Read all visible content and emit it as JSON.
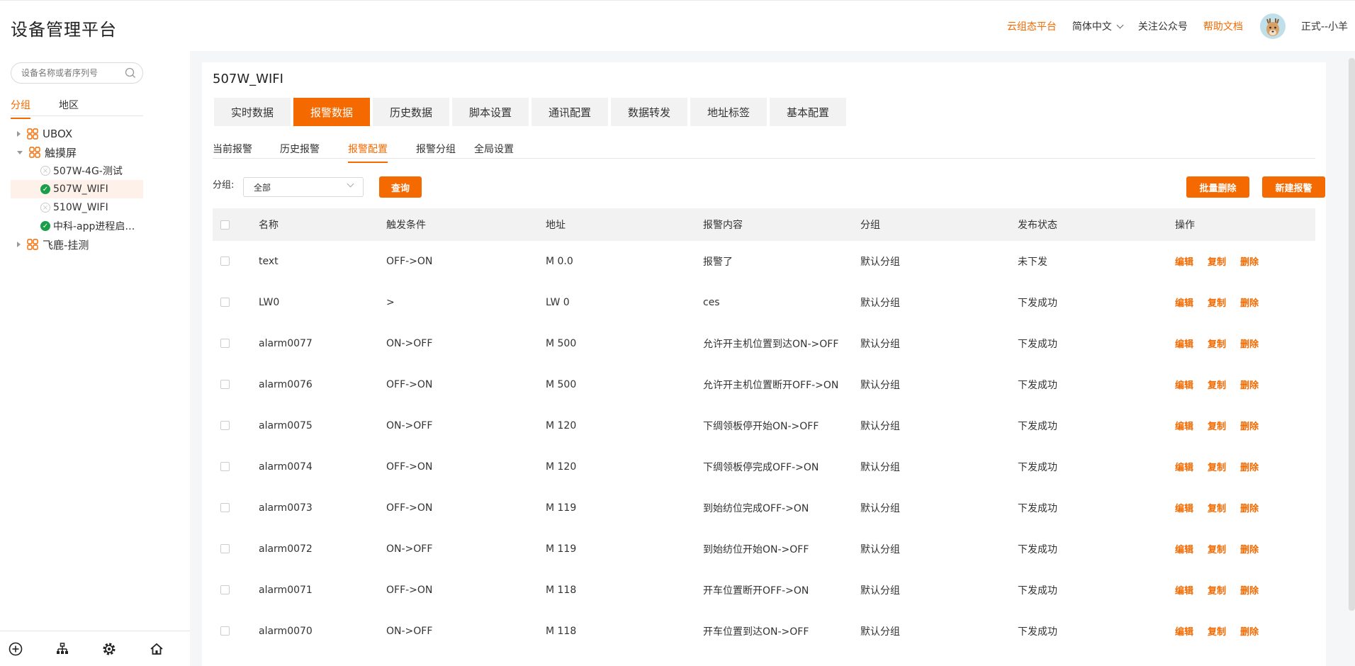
{
  "app": {
    "title": "设备管理平台"
  },
  "topnav": {
    "cloud": "云组态平台",
    "lang": "简体中文",
    "follow": "关注公众号",
    "help": "帮助文档",
    "user": "正式--小羊"
  },
  "sidebar": {
    "search_placeholder": "设备名称或者序列号",
    "tabs": [
      "分组",
      "地区"
    ],
    "tree": [
      {
        "label": "UBOX",
        "expanded": false,
        "children": []
      },
      {
        "label": "触摸屏",
        "expanded": true,
        "children": [
          {
            "label": "507W-4G-测试",
            "status": "offline"
          },
          {
            "label": "507W_WIFI",
            "status": "online",
            "selected": true
          },
          {
            "label": "510W_WIFI",
            "status": "offline"
          },
          {
            "label": "中科-app进程启…",
            "status": "online"
          }
        ]
      },
      {
        "label": "飞鹿-挂测",
        "expanded": false,
        "children": []
      }
    ]
  },
  "main": {
    "device_title": "507W_WIFI",
    "tabs": [
      "实时数据",
      "报警数据",
      "历史数据",
      "脚本设置",
      "通讯配置",
      "数据转发",
      "地址标签",
      "基本配置"
    ],
    "active_tab": 1,
    "subtabs": [
      "当前报警",
      "历史报警",
      "报警配置",
      "报警分组",
      "全局设置"
    ],
    "active_subtab": 2,
    "filter_label": "分组:",
    "filter_value": "全部",
    "query_btn": "查询",
    "batch_delete_btn": "批量删除",
    "new_alarm_btn": "新建报警",
    "columns": [
      "名称",
      "触发条件",
      "地址",
      "报警内容",
      "分组",
      "发布状态",
      "操作"
    ],
    "actions": [
      "编辑",
      "复制",
      "删除"
    ],
    "rows": [
      [
        "text",
        "OFF->ON",
        "M 0.0",
        "报警了",
        "默认分组",
        "未下发"
      ],
      [
        "LW0",
        ">",
        "LW 0",
        "ces",
        "默认分组",
        "下发成功"
      ],
      [
        "alarm0077",
        "ON->OFF",
        "M 500",
        "允许开主机位置到达ON->OFF",
        "默认分组",
        "下发成功"
      ],
      [
        "alarm0076",
        "OFF->ON",
        "M 500",
        "允许开主机位置断开OFF->ON",
        "默认分组",
        "下发成功"
      ],
      [
        "alarm0075",
        "ON->OFF",
        "M 120",
        "下绸领板停开始ON->OFF",
        "默认分组",
        "下发成功"
      ],
      [
        "alarm0074",
        "OFF->ON",
        "M 120",
        "下绸领板停完成OFF->ON",
        "默认分组",
        "下发成功"
      ],
      [
        "alarm0073",
        "OFF->ON",
        "M 119",
        "到始纺位完成OFF->ON",
        "默认分组",
        "下发成功"
      ],
      [
        "alarm0072",
        "ON->OFF",
        "M 119",
        "到始纺位开始ON->OFF",
        "默认分组",
        "下发成功"
      ],
      [
        "alarm0071",
        "OFF->ON",
        "M 118",
        "开车位置断开OFF->ON",
        "默认分组",
        "下发成功"
      ],
      [
        "alarm0070",
        "ON->OFF",
        "M 118",
        "开车位置到达ON->OFF",
        "默认分组",
        "下发成功"
      ]
    ]
  }
}
